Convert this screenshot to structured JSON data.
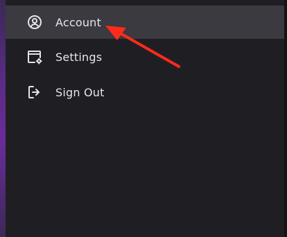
{
  "menu": {
    "items": [
      {
        "label": "Account",
        "icon": "account-circle-icon",
        "active": true
      },
      {
        "label": "Settings",
        "icon": "settings-window-icon",
        "active": false
      },
      {
        "label": "Sign Out",
        "icon": "sign-out-icon",
        "active": false
      }
    ]
  },
  "colors": {
    "background": "#1f1f23",
    "active_item": "#3a3a40",
    "text": "#e5e5ea",
    "annotation_arrow": "#ff2b1a",
    "accent_strip": "#6a2b9a"
  }
}
